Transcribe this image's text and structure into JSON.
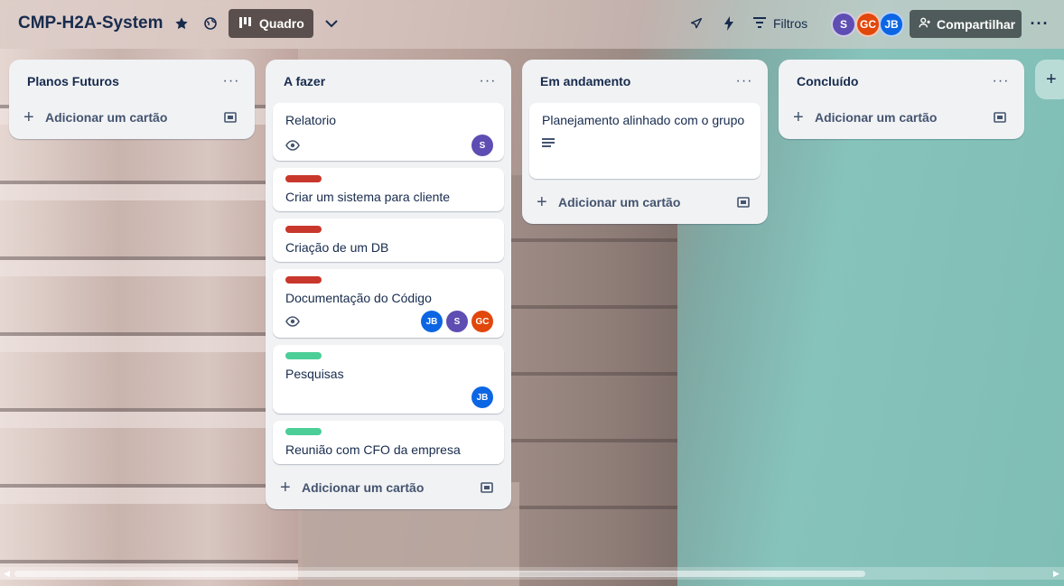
{
  "header": {
    "board_title": "CMP-H2A-System",
    "view_label": "Quadro",
    "filter_label": "Filtros",
    "share_label": "Compartilhar",
    "members": [
      {
        "initials": "S",
        "color": "#5e4db2"
      },
      {
        "initials": "GC",
        "color": "#e2470b"
      },
      {
        "initials": "JB",
        "color": "#0c66e4"
      }
    ],
    "icons": [
      "star-icon",
      "globe-icon",
      "board-view-icon",
      "chevron-down-icon",
      "rocket-icon",
      "lightning-icon",
      "filter-icon",
      "add-person-icon",
      "more-icon"
    ]
  },
  "lists": [
    {
      "title": "Planos Futuros",
      "add_label": "Adicionar um cartão",
      "cards": []
    },
    {
      "title": "A fazer",
      "add_label": "Adicionar um cartão",
      "cards": [
        {
          "title": "Relatorio",
          "label_color": null,
          "watching": true,
          "members": [
            "S"
          ]
        },
        {
          "title": "Criar um sistema para cliente",
          "label_color": "#c9372c",
          "watching": false,
          "members": []
        },
        {
          "title": "Criação de um DB",
          "label_color": "#c9372c",
          "watching": false,
          "members": []
        },
        {
          "title": "Documentação do Código",
          "label_color": "#c9372c",
          "watching": true,
          "members": [
            "JB",
            "S",
            "GC"
          ]
        },
        {
          "title": "Pesquisas",
          "label_color": "#4bce97",
          "watching": false,
          "members": [
            "JB"
          ]
        },
        {
          "title": "Reunião com CFO da empresa",
          "label_color": "#4bce97",
          "watching": false,
          "members": []
        }
      ]
    },
    {
      "title": "Em andamento",
      "add_label": "Adicionar um cartão",
      "cards": [
        {
          "title": "Planejamento alinhado com o grupo",
          "label_color": null,
          "has_description": true,
          "members": []
        }
      ]
    },
    {
      "title": "Concluído",
      "add_label": "Adicionar um cartão",
      "cards": []
    }
  ],
  "colors": {
    "label_red": "#c9372c",
    "label_green": "#4bce97",
    "avatar_S": "#5e4db2",
    "avatar_GC": "#e2470b",
    "avatar_JB": "#0c66e4"
  }
}
